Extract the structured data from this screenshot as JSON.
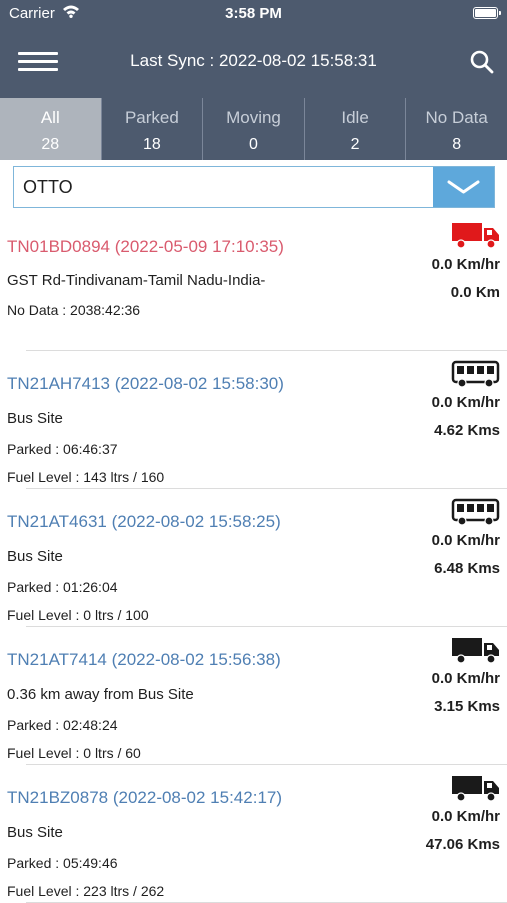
{
  "status_bar": {
    "carrier": "Carrier",
    "time": "3:58 PM"
  },
  "header": {
    "title": "Last Sync : 2022-08-02 15:58:31"
  },
  "tabs": [
    {
      "label": "All",
      "count": "28"
    },
    {
      "label": "Parked",
      "count": "18"
    },
    {
      "label": "Moving",
      "count": "0"
    },
    {
      "label": "Idle",
      "count": "2"
    },
    {
      "label": "No Data",
      "count": "8"
    }
  ],
  "filter": {
    "value": "OTTO"
  },
  "colors": {
    "header_bg": "#4d5a6e",
    "active_tab": "#aeb4bc",
    "accent": "#5ea8db",
    "no_data": "#d95b6e",
    "link": "#4f7fb3",
    "no_data_icon": "#e0191b"
  },
  "vehicles": [
    {
      "title": "TN01BD0894 (2022-05-09 17:10:35)",
      "location": "GST Rd-Tindivanam-Tamil Nadu-India-",
      "status": "No Data : 2038:42:36",
      "fuel": "",
      "speed": "0.0 Km/hr",
      "distance": "0.0 Km",
      "icon": "truck-icon"
    },
    {
      "title": "TN21AH7413 (2022-08-02 15:58:30)",
      "location": "Bus Site",
      "status": "Parked :  06:46:37",
      "fuel": "Fuel Level :  143  ltrs /  160",
      "speed": "0.0 Km/hr",
      "distance": "4.62 Kms",
      "icon": "bus-icon"
    },
    {
      "title": "TN21AT4631 (2022-08-02 15:58:25)",
      "location": "Bus Site",
      "status": "Parked :  01:26:04",
      "fuel": "Fuel Level :  0  ltrs /  100",
      "speed": "0.0 Km/hr",
      "distance": "6.48 Kms",
      "icon": "bus-icon"
    },
    {
      "title": "TN21AT7414 (2022-08-02 15:56:38)",
      "location": "0.36 km away from Bus Site",
      "status": "Parked :  02:48:24",
      "fuel": "Fuel Level :  0  ltrs /  60",
      "speed": "0.0 Km/hr",
      "distance": "3.15 Kms",
      "icon": "truck-icon"
    },
    {
      "title": "TN21BZ0878 (2022-08-02 15:42:17)",
      "location": "Bus Site",
      "status": "Parked :  05:49:46",
      "fuel": "Fuel Level :  223  ltrs /  262",
      "speed": "0.0 Km/hr",
      "distance": "47.06 Kms",
      "icon": "truck-icon"
    }
  ]
}
